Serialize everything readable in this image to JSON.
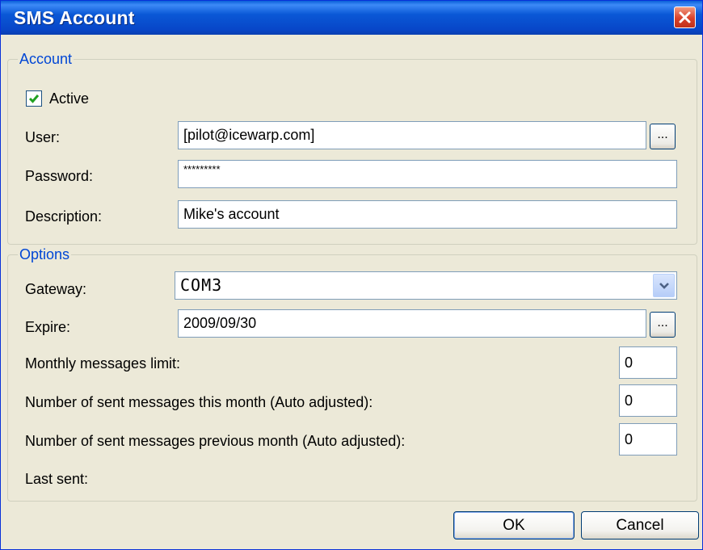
{
  "window": {
    "title": "SMS Account",
    "close_icon": "close-icon"
  },
  "account": {
    "legend": "Account",
    "active_label": "Active",
    "active_checked": true,
    "user_label": "User:",
    "user_value": "[pilot@icewarp.com]",
    "user_browse_label": "...",
    "password_label": "Password:",
    "password_value": "*********",
    "description_label": "Description:",
    "description_value": "Mike's account"
  },
  "options": {
    "legend": "Options",
    "gateway_label": "Gateway:",
    "gateway_value": "COM3",
    "expire_label": "Expire:",
    "expire_value": "2009/09/30",
    "expire_browse_label": "...",
    "monthly_limit_label": "Monthly messages limit:",
    "monthly_limit_value": "0",
    "sent_this_month_label": "Number of sent messages this month (Auto adjusted):",
    "sent_this_month_value": "0",
    "sent_prev_month_label": "Number of sent messages previous month (Auto adjusted):",
    "sent_prev_month_value": "0",
    "last_sent_label": "Last sent:"
  },
  "buttons": {
    "ok_label": "OK",
    "cancel_label": "Cancel"
  },
  "colors": {
    "titlebar": "#0a58d6",
    "legend_text": "#0046d5",
    "dialog_bg": "#ece9d8",
    "close_button": "#d9412a"
  }
}
